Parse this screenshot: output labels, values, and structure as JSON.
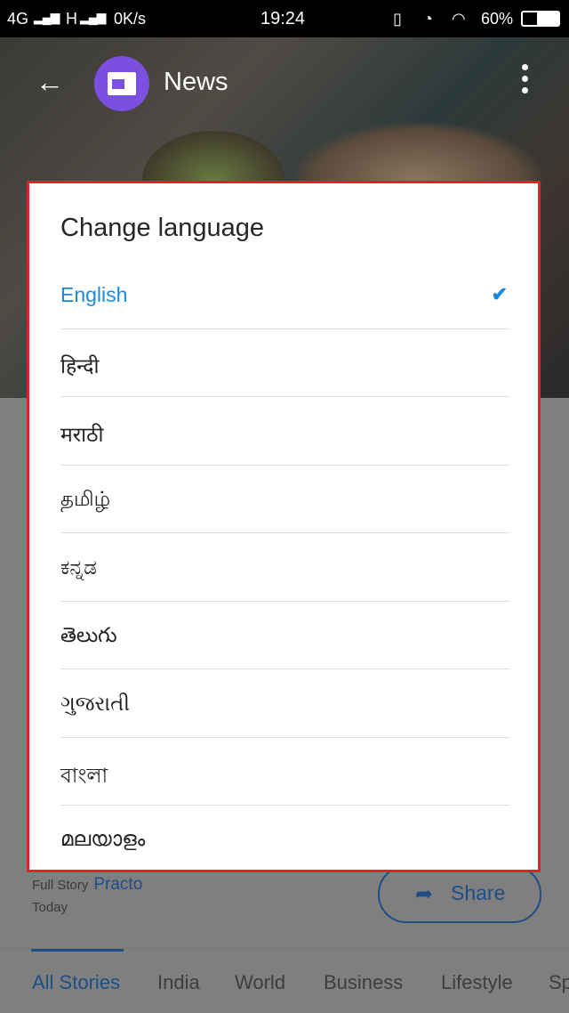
{
  "status_bar": {
    "network": "4G",
    "network2": "H",
    "speed": "0K/s",
    "time": "19:24",
    "battery": "60%"
  },
  "app_bar": {
    "title": "News"
  },
  "dialog": {
    "title": "Change language",
    "selected": "English",
    "languages": [
      {
        "label": "English"
      },
      {
        "label": "हिन्दी"
      },
      {
        "label": "मराठी"
      },
      {
        "label": "தமிழ்"
      },
      {
        "label": "ಕನ್ನಡ"
      },
      {
        "label": "తెలుగు"
      },
      {
        "label": "ગુજરાતી"
      },
      {
        "label": "বাংলা"
      },
      {
        "label": "മലയാളം"
      }
    ]
  },
  "story": {
    "full_story_label": "Full Story",
    "source": "Practo",
    "date": "Today",
    "share_label": "Share"
  },
  "tabs": [
    {
      "label": "All Stories"
    },
    {
      "label": "India"
    },
    {
      "label": "World"
    },
    {
      "label": "Business"
    },
    {
      "label": "Lifestyle"
    },
    {
      "label": "Sp"
    }
  ],
  "colors": {
    "accent": "#1f88d9",
    "brand": "#7b4fe0",
    "highlight": "#e0202a"
  }
}
